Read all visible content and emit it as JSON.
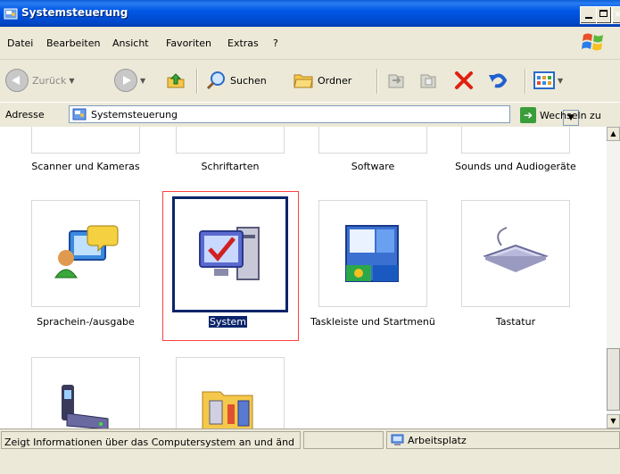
{
  "window": {
    "title": "Systemsteuerung"
  },
  "menu": [
    "Datei",
    "Bearbeiten",
    "Ansicht",
    "Favoriten",
    "Extras",
    "?"
  ],
  "toolbar": {
    "back_label": "Zurück",
    "search_label": "Suchen",
    "folders_label": "Ordner"
  },
  "address": {
    "label": "Adresse",
    "value": "Systemsteuerung",
    "go_label": "Wechseln zu"
  },
  "items": [
    {
      "label": "Scanner und Kameras",
      "icon": "scanner-camera-icon"
    },
    {
      "label": "Schriftarten",
      "icon": "fonts-icon"
    },
    {
      "label": "Software",
      "icon": "software-icon"
    },
    {
      "label": "Sounds und Audiogeräte",
      "icon": "sounds-icon"
    },
    {
      "label": "Sprachein-/ausgabe",
      "icon": "speech-icon"
    },
    {
      "label": "System",
      "icon": "system-icon",
      "selected": true
    },
    {
      "label": "Taskleiste und Startmenü",
      "icon": "taskbar-icon"
    },
    {
      "label": "Tastatur",
      "icon": "keyboard-icon"
    },
    {
      "label": "",
      "icon": "phone-modem-icon"
    },
    {
      "label": "",
      "icon": "admin-tools-icon"
    }
  ],
  "status": {
    "text": "Zeigt Informationen über das Computersystem an und ändert verschiedene Einstellungen.",
    "zone": "Arbeitsplatz"
  },
  "colors": {
    "titlebar": "#0054e3",
    "selection": "#0a246a",
    "chrome": "#ece9d8"
  }
}
